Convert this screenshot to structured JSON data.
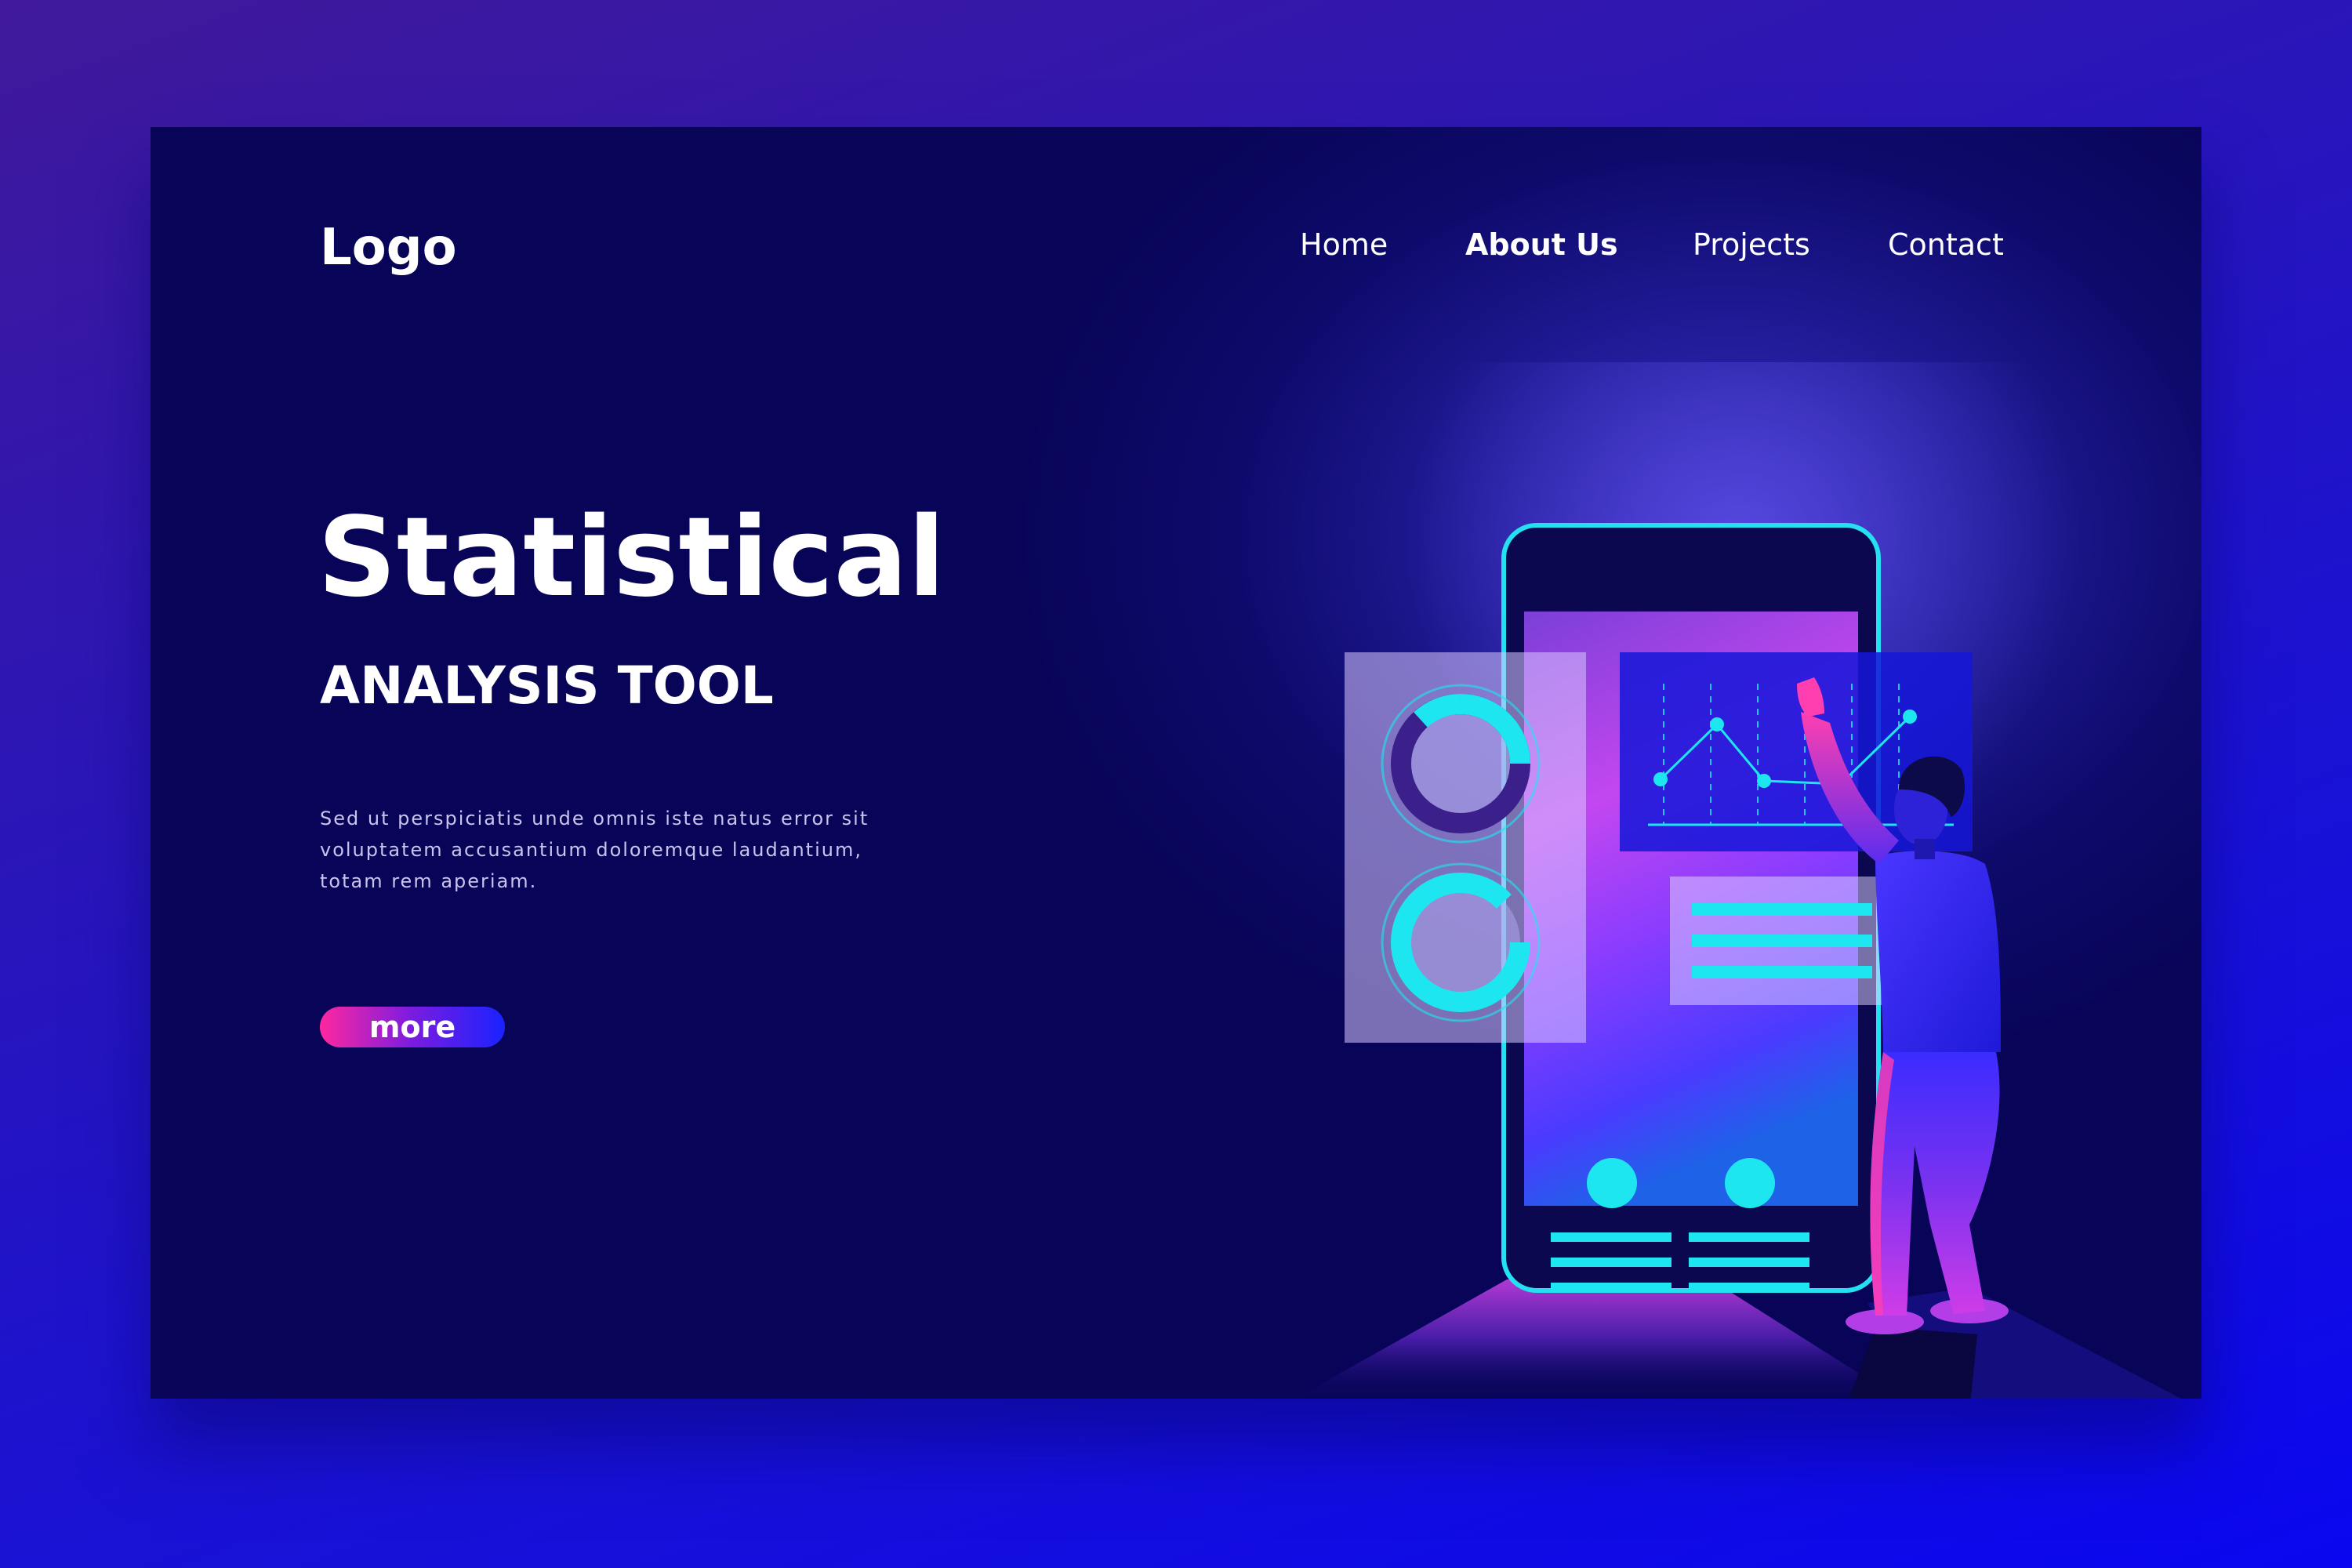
{
  "brand": {
    "logo_text": "Logo"
  },
  "nav": {
    "items": [
      {
        "label": "Home"
      },
      {
        "label": "About Us",
        "active": true
      },
      {
        "label": "Projects"
      },
      {
        "label": "Contact"
      }
    ]
  },
  "hero": {
    "title": "Statistical",
    "subtitle": "ANALYSIS TOOL",
    "body_lines": [
      "Sed ut perspiciatis unde omnis iste natus error sit",
      "voluptatem accusantium doloremque laudantium,",
      "totam rem aperiam."
    ],
    "cta_label": "more"
  },
  "colors": {
    "accent_cyan": "#1ee6f0",
    "accent_pink": "#ff27a0",
    "accent_blue": "#1a22ff",
    "card_dark": "#080559"
  },
  "illustration": {
    "icons": [
      "smartphone",
      "donut-chart",
      "line-chart",
      "text-lines",
      "person-pointing"
    ]
  }
}
